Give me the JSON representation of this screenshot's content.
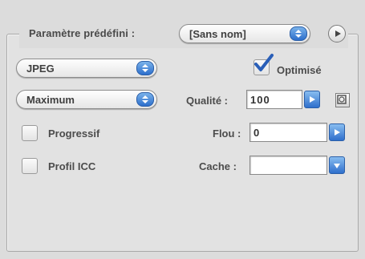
{
  "preset": {
    "label": "Paramètre prédéfini :",
    "selected": "[Sans nom]",
    "menu_icon": "play-arrow-icon"
  },
  "format": {
    "selected": "JPEG"
  },
  "quality_preset": {
    "selected": "Maximum"
  },
  "optimise": {
    "label": "Optimisé",
    "checked": true
  },
  "progressive": {
    "label": "Progressif",
    "checked": false
  },
  "icc_profile": {
    "label": "Profil ICC",
    "checked": false
  },
  "quality": {
    "label": "Qualité :",
    "value": "100"
  },
  "blur": {
    "label": "Flou :",
    "value": "0"
  },
  "matte": {
    "label": "Cache :",
    "value": ""
  },
  "colors": {
    "accent": "#2f6fcc",
    "check": "#2a5fb8"
  }
}
